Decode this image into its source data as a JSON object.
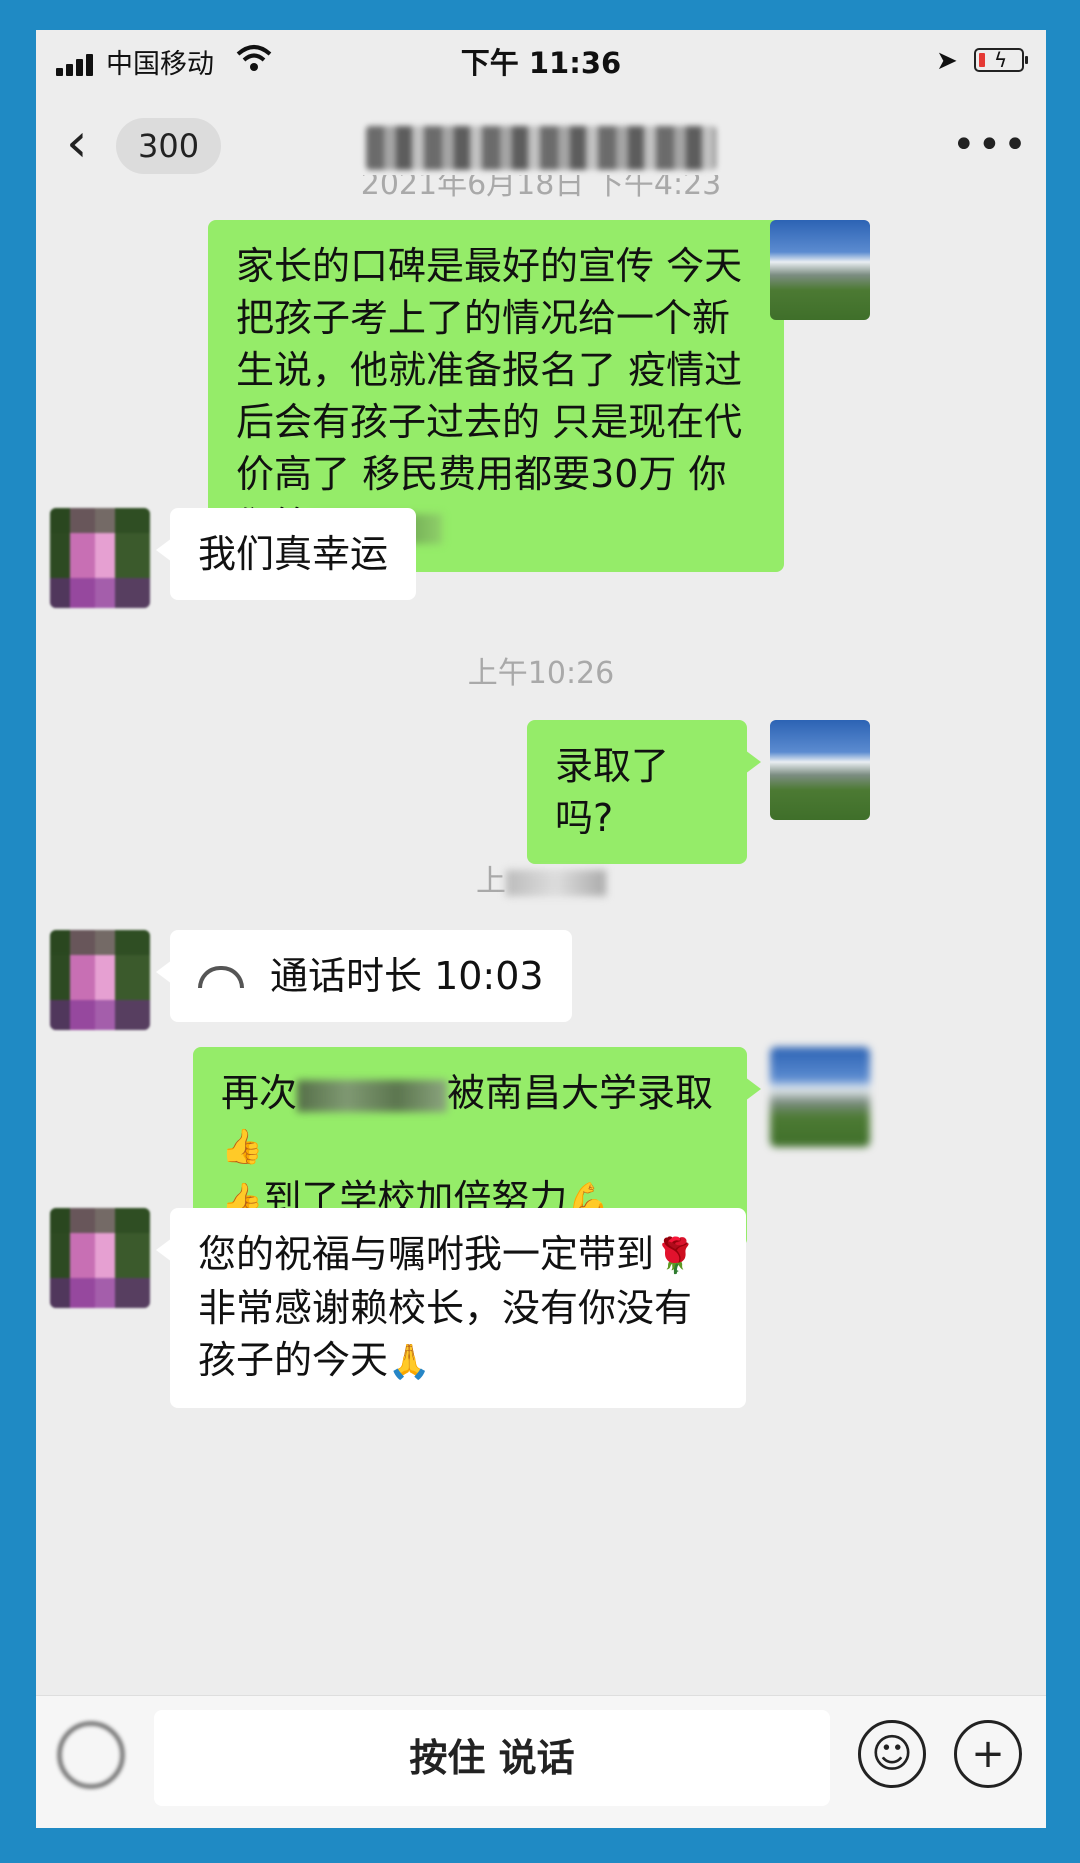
{
  "status_bar": {
    "carrier": "中国移动",
    "time": "下午 11:36"
  },
  "nav": {
    "back_badge": "300",
    "more": "•••"
  },
  "messages": {
    "ts1": "2021年6月18日 下午4:23",
    "m1": {
      "text": "家长的口碑是最好的宣传 今天把孩子考上了的情况给一个新生说，他就准备报名了 疫情过后会有孩子过去的 只是现在代价高了 移民费用都要30万 你们算"
    },
    "m2": {
      "text": "我们真幸运"
    },
    "ts2": "上午10:26",
    "m3": {
      "text": "录取了吗?"
    },
    "ts3_prefix": "上",
    "m4": {
      "text": "通话时长 10:03"
    },
    "m5": {
      "prefix": "再次",
      "suffix": "被南昌大学录取",
      "line2": "到了学校加倍努力"
    },
    "m6": {
      "text": "您的祝福与嘱咐我一定带到",
      "text2": "非常感谢赖校长，没有你没有孩子的今天"
    }
  },
  "bottom_bar": {
    "hold_to_talk": "按住 说话"
  },
  "colors": {
    "green_bubble": "#95ec69",
    "chat_bg": "#ededed",
    "frame": "#1f8ac4"
  }
}
